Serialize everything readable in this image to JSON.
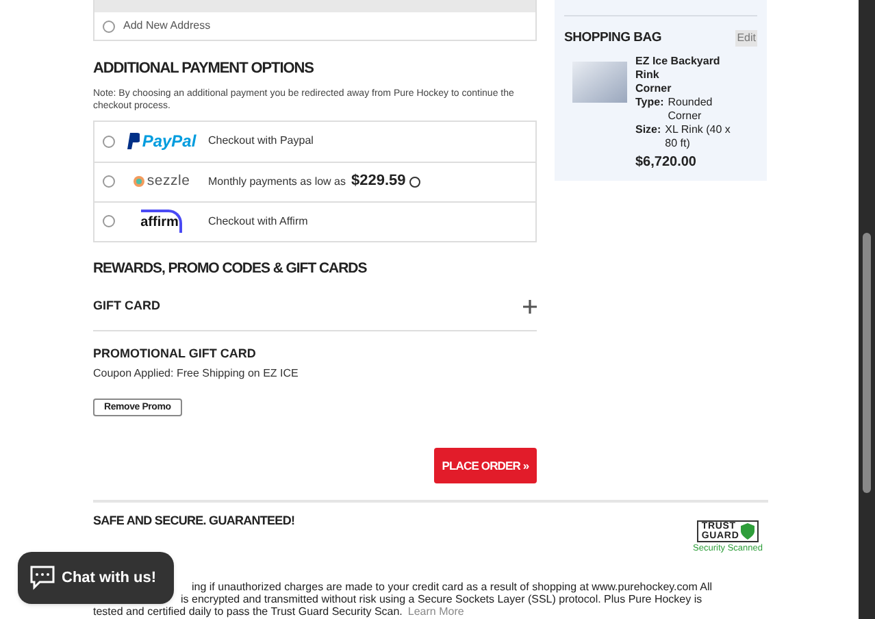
{
  "address_options": [
    {
      "label": "Add New Address",
      "selected": false
    }
  ],
  "payment": {
    "title": "ADDITIONAL PAYMENT OPTIONS",
    "note": "Note: By choosing an additional payment you be redirected away from Pure Hockey to continue the checkout process.",
    "options": [
      {
        "kind": "paypal",
        "logo": "PayPal",
        "text": "Checkout with Paypal",
        "selected": false
      },
      {
        "kind": "sezzle",
        "logo": "sezzle",
        "text": "Monthly payments as low as",
        "amount": "$229.59",
        "selected": false
      },
      {
        "kind": "affirm",
        "logo": "affirm",
        "text": "Checkout with Affirm",
        "selected": false
      }
    ]
  },
  "rewards": {
    "title": "REWARDS, PROMO CODES & GIFT CARDS",
    "gift_card": {
      "label": "GIFT CARD",
      "expanded": false
    },
    "promo": {
      "title": "PROMOTIONAL GIFT CARD",
      "text": "Coupon Applied: Free Shipping on EZ ICE",
      "button": "Remove Promo"
    }
  },
  "place_order": "PLACE ORDER »",
  "shopping_bag": {
    "title": "SHOPPING BAG",
    "edit": "Edit",
    "item": {
      "name": "EZ Ice Backyard Rink",
      "variant": "Corner",
      "attributes": [
        {
          "label": "Type:",
          "value": "Rounded Corner"
        },
        {
          "label": "Size:",
          "value": "XL Rink (40 x 80 ft)"
        }
      ],
      "price": "$6,720.00"
    }
  },
  "security": {
    "title": "SAFE AND SECURE. GUARANTEED!",
    "lines": [
      "ing if unauthorized charges are made to your credit card as a result of shopping at www.purehockey.com  All",
      "is encrypted and transmitted without risk using a Secure Sockets Layer (SSL) protocol.  Plus Pure Hockey is",
      "tested and certified daily to pass the Trust Guard Security Scan."
    ],
    "link": "Learn More",
    "badge": {
      "line1": "TRUST",
      "line2": "GUARD",
      "caption": "Security Scanned"
    }
  },
  "chat": {
    "label": "Chat with us!"
  }
}
